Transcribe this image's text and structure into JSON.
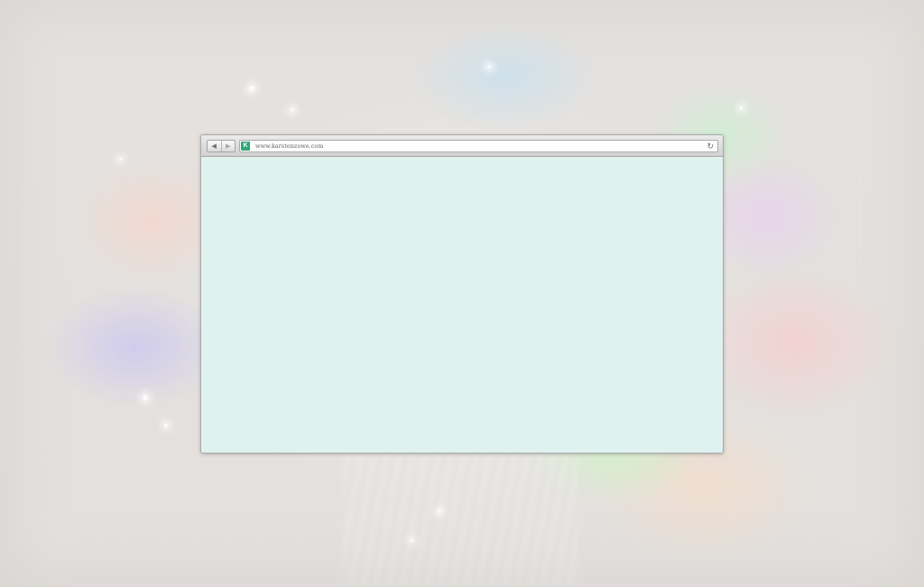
{
  "browser": {
    "address_bar": {
      "url": "www.karstenzowe.com",
      "favicon_letter": "K",
      "favicon_color": "#2ea878"
    },
    "nav": {
      "back_icon": "◀",
      "forward_icon": "▶",
      "reload_icon": "↻"
    },
    "icons": [
      "back-arrow-icon",
      "forward-arrow-icon",
      "favicon-icon",
      "reload-icon"
    ],
    "content_background": "#e0f2f0"
  },
  "theme": {
    "desktop_background": "#e4e1de",
    "toolbar_gradient": [
      "#ebebeb",
      "#d2d2d2"
    ]
  }
}
